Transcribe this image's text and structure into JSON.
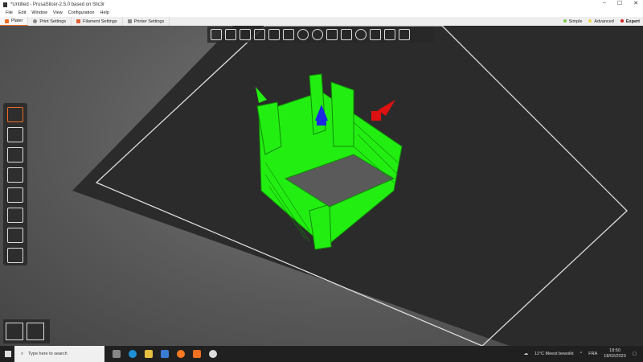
{
  "window": {
    "title": "*Untitled - PrusaSlicer-2.5.0 based on Slic3r",
    "controls": [
      "–",
      "☐",
      "✕"
    ]
  },
  "menu": [
    "File",
    "Edit",
    "Window",
    "View",
    "Configuration",
    "Help"
  ],
  "tabs": [
    {
      "label": "Plater",
      "color": "#ed6b21"
    },
    {
      "label": "Print Settings",
      "color": "#888"
    },
    {
      "label": "Filament Settings",
      "color": "#e06030"
    },
    {
      "label": "Printer Settings",
      "color": "#888"
    }
  ],
  "modes": [
    {
      "label": "Simple",
      "color": "#7ec850"
    },
    {
      "label": "Advanced",
      "color": "#e8d84a"
    },
    {
      "label": "Expert",
      "color": "#d02020"
    }
  ],
  "taskbar": {
    "search_placeholder": "Type here to search",
    "weather": "11°C  Meest bewolkt",
    "lang": "FRA",
    "time": "18:50",
    "date": "18/02/2023"
  },
  "colors": {
    "accent": "#ed6b21",
    "model": "#22ee11"
  }
}
